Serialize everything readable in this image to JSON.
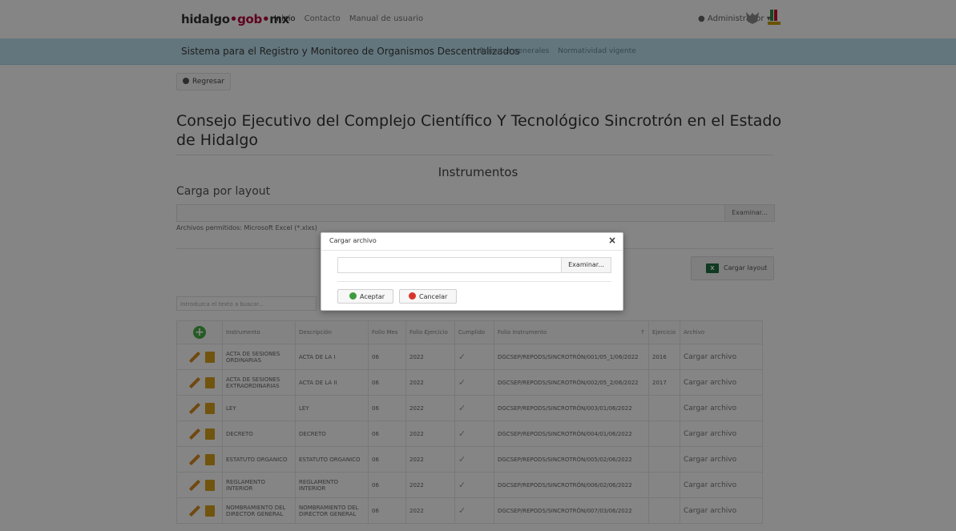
{
  "navbar": {
    "brand_main": "hidalgo",
    "brand_dot1": "•",
    "brand_gob": "gob",
    "brand_dot2": "•",
    "brand_mx": "mx",
    "links": [
      "Inicio",
      "Contacto",
      "Manual de usuario"
    ],
    "user": "Administrador"
  },
  "subbar": {
    "title": "Sistema para el Registro y Monitoreo de Organismos Descentralizados",
    "links": [
      "Reportes generales",
      "Normatividad vigente"
    ]
  },
  "page": {
    "back": "Regresar",
    "title": "Consejo Ejecutivo del Complejo Científico Y Tecnológico Sincrotrón en el Estado de Hidalgo",
    "section": "Instrumentos",
    "layout_heading": "Carga por layout",
    "browse": "Examinar...",
    "allowed": "Archivos permitidos: Microsoft Excel (*.xlxs)",
    "cargar_layout": "Cargar layout",
    "search_placeholder": "Introduzca el texto a buscar..."
  },
  "table": {
    "headers": [
      "Instrumento",
      "Descripción",
      "Folio Mes",
      "Folio Ejercicio",
      "Cumplido",
      "Folio Instrumento",
      "Ejercicio",
      "Archivo"
    ],
    "sort_indicator": "↑",
    "rows": [
      {
        "instrumento": "ACTA DE SESIONES ORDINARIAS",
        "descripcion": "ACTA DE LA I",
        "mes": "06",
        "folio_ejercicio": "2022",
        "cumplido": "✓",
        "folio": "DGCSEP/REPODS/SINCROTRÓN/001/05_1/06/2022",
        "ejercicio": "2016",
        "archivo": "Cargar archivo"
      },
      {
        "instrumento": "ACTA DE SESIONES EXTRAORDINARIAS",
        "descripcion": "ACTA DE LA II",
        "mes": "06",
        "folio_ejercicio": "2022",
        "cumplido": "✓",
        "folio": "DGCSEP/REPODS/SINCROTRÓN/002/05_2/06/2022",
        "ejercicio": "2017",
        "archivo": "Cargar archivo"
      },
      {
        "instrumento": "LEY",
        "descripcion": "LEY",
        "mes": "06",
        "folio_ejercicio": "2022",
        "cumplido": "✓",
        "folio": "DGCSEP/REPODS/SINCROTRÓN/003/01/06/2022",
        "ejercicio": "",
        "archivo": "Cargar archivo"
      },
      {
        "instrumento": "DECRETO",
        "descripcion": "DECRETO",
        "mes": "06",
        "folio_ejercicio": "2022",
        "cumplido": "✓",
        "folio": "DGCSEP/REPODS/SINCROTRÓN/004/01/06/2022",
        "ejercicio": "",
        "archivo": "Cargar archivo"
      },
      {
        "instrumento": "ESTATUTO ORGANICO",
        "descripcion": "ESTATUTO ORGANICO",
        "mes": "06",
        "folio_ejercicio": "2022",
        "cumplido": "✓",
        "folio": "DGCSEP/REPODS/SINCROTRÓN/005/02/06/2022",
        "ejercicio": "",
        "archivo": "Cargar archivo"
      },
      {
        "instrumento": "REGLAMENTO INTERIOR",
        "descripcion": "REGLAMENTO INTERIOR",
        "mes": "06",
        "folio_ejercicio": "2022",
        "cumplido": "✓",
        "folio": "DGCSEP/REPODS/SINCROTRÓN/006/02/06/2022",
        "ejercicio": "",
        "archivo": "Cargar archivo"
      },
      {
        "instrumento": "NOMBRAMIENTO DEL DIRECTOR GENERAL",
        "descripcion": "NOMBRAMIENTO DEL DIRECTOR GENERAL",
        "mes": "06",
        "folio_ejercicio": "2022",
        "cumplido": "✓",
        "folio": "DGCSEP/REPODS/SINCROTRÓN/007/03/06/2022",
        "ejercicio": "",
        "archivo": "Cargar archivo"
      }
    ]
  },
  "modal": {
    "title": "Cargar archivo",
    "close": "×",
    "browse": "Examinar...",
    "accept": "Aceptar",
    "cancel": "Cancelar"
  }
}
